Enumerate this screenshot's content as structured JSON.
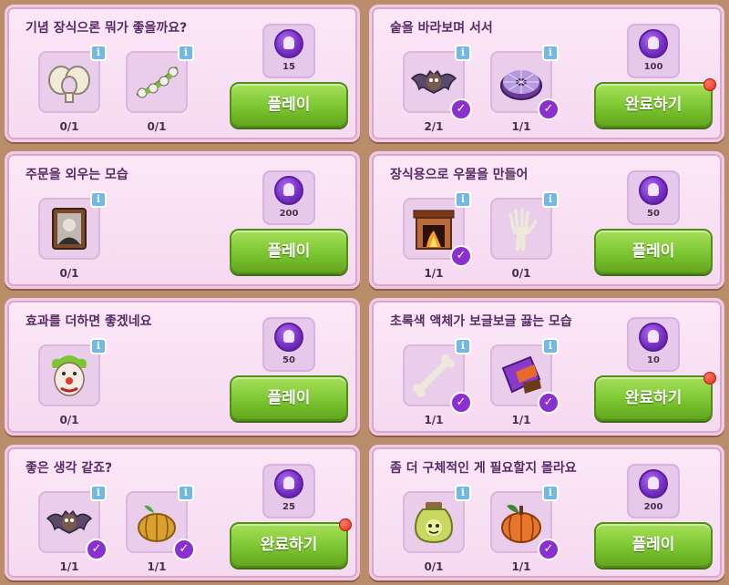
{
  "quests": [
    {
      "title": "기념 장식으론 뭐가 좋을까요?",
      "items": [
        {
          "icon": "pelvis-bone-icon",
          "count": "0/1",
          "done": false
        },
        {
          "icon": "garland-icon",
          "count": "0/1",
          "done": false
        }
      ],
      "reward": "15",
      "button": "플레이",
      "alert": false
    },
    {
      "title": "숱을 바라보며 서서",
      "items": [
        {
          "icon": "bat-icon",
          "count": "2/1",
          "done": true
        },
        {
          "icon": "web-donut-icon",
          "count": "1/1",
          "done": true
        }
      ],
      "reward": "100",
      "button": "완료하기",
      "alert": true
    },
    {
      "title": "주문을 외우는 모습",
      "items": [
        {
          "icon": "portrait-icon",
          "count": "0/1",
          "done": false
        }
      ],
      "reward": "200",
      "button": "플레이",
      "alert": false
    },
    {
      "title": "장식용으로 우물을 만들어",
      "items": [
        {
          "icon": "fireplace-icon",
          "count": "1/1",
          "done": true
        },
        {
          "icon": "skeleton-hand-icon",
          "count": "0/1",
          "done": false
        }
      ],
      "reward": "50",
      "button": "플레이",
      "alert": false
    },
    {
      "title": "효과를 더하면 좋겠네요",
      "items": [
        {
          "icon": "clown-mask-icon",
          "count": "0/1",
          "done": false
        }
      ],
      "reward": "50",
      "button": "플레이",
      "alert": false
    },
    {
      "title": "초록색 액체가 보글보글 끓는 모습",
      "items": [
        {
          "icon": "bone-icon",
          "count": "1/1",
          "done": true
        },
        {
          "icon": "candy-bar-icon",
          "count": "1/1",
          "done": true
        }
      ],
      "reward": "10",
      "button": "완료하기",
      "alert": true
    },
    {
      "title": "좋은 생각 같죠?",
      "items": [
        {
          "icon": "bat-icon",
          "count": "1/1",
          "done": true
        },
        {
          "icon": "pumpkin-icon",
          "count": "1/1",
          "done": true
        }
      ],
      "reward": "25",
      "button": "완료하기",
      "alert": true
    },
    {
      "title": "좀 더 구체적인 게 필요할지 몰라요",
      "items": [
        {
          "icon": "potion-jar-icon",
          "count": "0/1",
          "done": false
        },
        {
          "icon": "orange-pumpkin-icon",
          "count": "1/1",
          "done": true
        }
      ],
      "reward": "200",
      "button": "플레이",
      "alert": false
    }
  ],
  "ui": {
    "info_glyph": "i",
    "check_glyph": "✓"
  },
  "colors": {
    "button_green": "#7cc631",
    "coin_purple": "#7a2fc8",
    "card_pink": "#f6d9f1",
    "alert_red": "#e52a12"
  }
}
